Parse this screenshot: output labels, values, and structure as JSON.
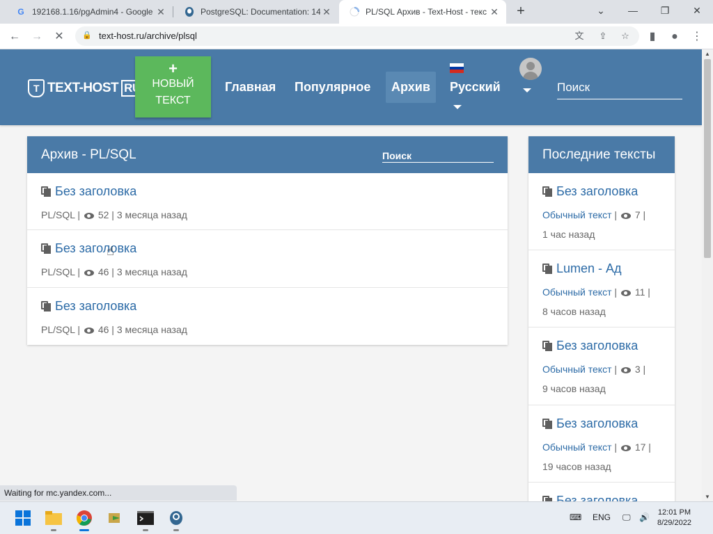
{
  "browser": {
    "tabs": [
      {
        "title": "192168.1.16/pgAdmin4 - Google",
        "favicon": "G"
      },
      {
        "title": "PostgreSQL: Documentation: 14:",
        "favicon": "elephant"
      },
      {
        "title": "PL/SQL Архив - Text-Host - текс",
        "favicon": "spinner"
      }
    ],
    "url": "text-host.ru/archive/plsql",
    "status_text": "Waiting for mc.yandex.com..."
  },
  "header": {
    "logo_text": "TEXT-HOST",
    "logo_suffix": "RU",
    "logo_mark": "T",
    "new_button_plus": "+",
    "new_button_label_line1": "НОВЫЙ",
    "new_button_label_line2": "ТЕКСТ",
    "nav": [
      "Главная",
      "Популярное",
      "Архив"
    ],
    "active_nav": "Архив",
    "language": "Русский",
    "search_placeholder": "Поиск"
  },
  "archive": {
    "title": "Архив - PL/SQL",
    "search_placeholder": "Поиск",
    "items": [
      {
        "title": "Без заголовка",
        "lang": "PL/SQL",
        "views": "52",
        "age": "3 месяца назад"
      },
      {
        "title": "Без заголовка",
        "lang": "PL/SQL",
        "views": "46",
        "age": "3 месяца назад"
      },
      {
        "title": "Без заголовка",
        "lang": "PL/SQL",
        "views": "46",
        "age": "3 месяца назад"
      }
    ]
  },
  "recent": {
    "title": "Последние тексты",
    "items": [
      {
        "title": "Без заголовка",
        "type": "Обычный текст",
        "views": "7",
        "age": "1 час назад"
      },
      {
        "title": "Lumen - Ад",
        "type": "Обычный текст",
        "views": "11",
        "age": "8 часов назад"
      },
      {
        "title": "Без заголовка",
        "type": "Обычный текст",
        "views": "3",
        "age": "9 часов назад"
      },
      {
        "title": "Без заголовка",
        "type": "Обычный текст",
        "views": "17",
        "age": "19 часов назад"
      },
      {
        "title": "Без заголовка",
        "type": "",
        "views": "",
        "age": ""
      }
    ]
  },
  "taskbar": {
    "language": "ENG",
    "time": "12:01 PM",
    "date": "8/29/2022"
  },
  "colors": {
    "header_blue": "#4a7aa7",
    "new_button_green": "#5cb85c",
    "link_blue": "#2b6aa6"
  }
}
